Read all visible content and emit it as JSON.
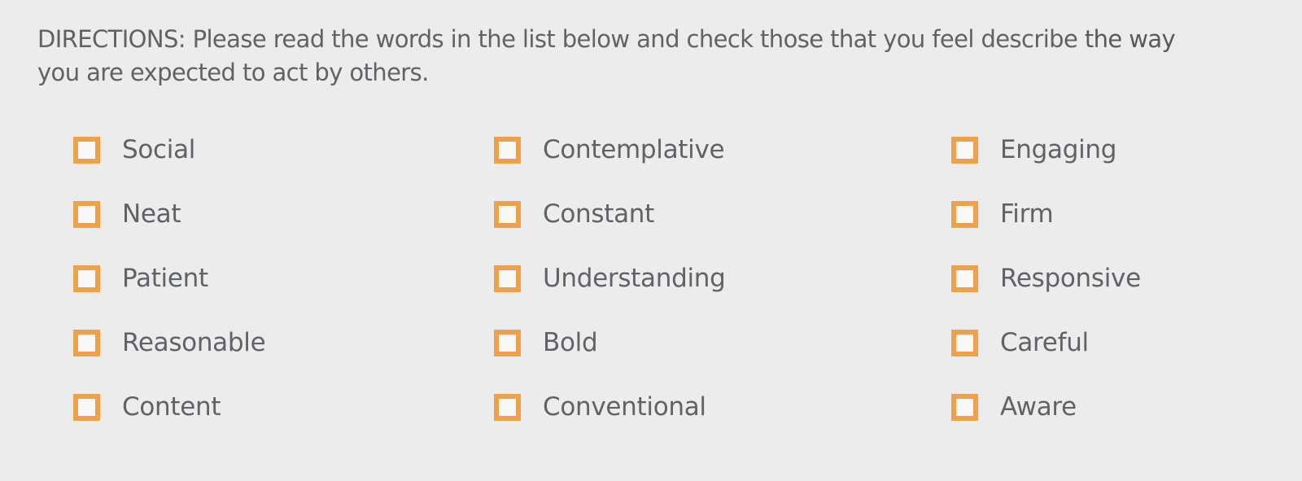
{
  "directions": {
    "text_main": "DIRECTIONS: Please read the words in the list below and check those that you feel describe ",
    "text_emph_1": "the way",
    "text_line2": "you are expected to act by others."
  },
  "colors": {
    "checkbox_border": "#f0a04b",
    "checkbox_fill": "#f8f8f9",
    "background": "#ececec",
    "text": "#5f6266"
  },
  "columns": [
    {
      "items": [
        {
          "label": "Social",
          "checked": false
        },
        {
          "label": "Neat",
          "checked": false
        },
        {
          "label": "Patient",
          "checked": false
        },
        {
          "label": "Reasonable",
          "checked": false
        },
        {
          "label": "Content",
          "checked": false
        }
      ]
    },
    {
      "items": [
        {
          "label": "Contemplative",
          "checked": false
        },
        {
          "label": "Constant",
          "checked": false
        },
        {
          "label": "Understanding",
          "checked": false
        },
        {
          "label": "Bold",
          "checked": false
        },
        {
          "label": "Conventional",
          "checked": false
        }
      ]
    },
    {
      "items": [
        {
          "label": "Engaging",
          "checked": false
        },
        {
          "label": "Firm",
          "checked": false
        },
        {
          "label": "Responsive",
          "checked": false
        },
        {
          "label": "Careful",
          "checked": false
        },
        {
          "label": "Aware",
          "checked": false
        }
      ]
    }
  ]
}
